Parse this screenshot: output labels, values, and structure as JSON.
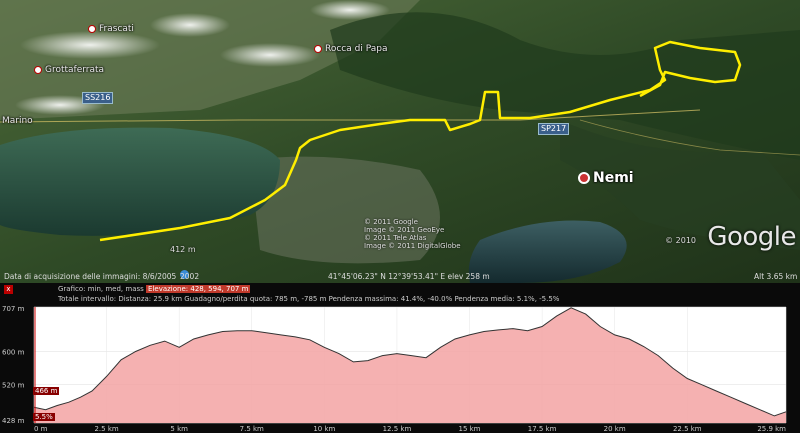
{
  "map": {
    "places": [
      {
        "name": "Frascati",
        "label": "Frascati"
      },
      {
        "name": "Grottaferrata",
        "label": "Grottaferrata"
      },
      {
        "name": "Rocca di Papa",
        "label": "Rocca di Papa"
      },
      {
        "name": "Marino",
        "label": "Marino"
      },
      {
        "name": "Nemi",
        "label": "Nemi"
      }
    ],
    "roads": {
      "r1": "SS216",
      "r2": "SP217"
    },
    "elevation_marker": "412 m",
    "copyright": "© 2011 Google\nImage © 2011 GeoEye\n© 2011 Tele Atlas\nImage © 2011 DigitalGlobe",
    "image_year": "© 2010",
    "logo": "Google",
    "route_color": "#ffee00"
  },
  "status": {
    "acquisition": "Data di acquisizione delle immagini: 8/6/2005",
    "tour_year": "2002",
    "coords": "41°45'06.23\" N  12°39'53.41\" E  elev  258 m",
    "alt": "Alt  3.65 km"
  },
  "profile": {
    "header_line1_prefix": "Grafico: min, med, mass",
    "elevation_label": "Elevazione: 428, 594, 707 m",
    "header_line2": "Totale intervallo: Distanza: 25.9 km   Guadagno/perdita quota: 785 m, -785 m   Pendenza massima: 41.4%, -40.0%   Pendenza media: 5.1%, -5.5%",
    "current_readout": "466 m",
    "current_slope": "5.5%",
    "close_label": "x"
  },
  "chart_data": {
    "type": "area",
    "title": "",
    "xlabel": "",
    "ylabel": "",
    "xlim": [
      0,
      25.9
    ],
    "ylim": [
      428,
      707
    ],
    "y_ticks": [
      {
        "v": 707,
        "label": "707 m"
      },
      {
        "v": 600,
        "label": "600 m"
      },
      {
        "v": 520,
        "label": "520 m"
      },
      {
        "v": 428,
        "label": "428 m"
      }
    ],
    "x_ticks": [
      {
        "v": 0,
        "label": "0 m"
      },
      {
        "v": 2.5,
        "label": "2.5 km"
      },
      {
        "v": 5,
        "label": "5 km"
      },
      {
        "v": 7.5,
        "label": "7.5 km"
      },
      {
        "v": 10,
        "label": "10 km"
      },
      {
        "v": 12.5,
        "label": "12.5 km"
      },
      {
        "v": 15,
        "label": "15 km"
      },
      {
        "v": 17.5,
        "label": "17.5 km"
      },
      {
        "v": 20,
        "label": "20 km"
      },
      {
        "v": 22.5,
        "label": "22.5 km"
      },
      {
        "v": 25.9,
        "label": "25.9 km"
      }
    ],
    "series": [
      {
        "x": [
          0,
          0.4,
          0.8,
          1.2,
          1.6,
          2.0,
          2.5,
          3.0,
          3.5,
          4.0,
          4.5,
          5.0,
          5.5,
          6.0,
          6.5,
          7.0,
          7.5,
          8.0,
          8.5,
          9.0,
          9.5,
          10.0,
          10.5,
          11.0,
          11.5,
          12.0,
          12.5,
          13.0,
          13.5,
          14.0,
          14.5,
          15.0,
          15.5,
          16.0,
          16.5,
          17.0,
          17.5,
          18.0,
          18.5,
          19.0,
          19.5,
          20.0,
          20.5,
          21.0,
          21.5,
          22.0,
          22.5,
          23.0,
          23.5,
          24.0,
          24.5,
          25.0,
          25.5,
          25.9
        ],
        "y": [
          466,
          460,
          470,
          478,
          490,
          505,
          540,
          580,
          600,
          615,
          625,
          610,
          630,
          640,
          648,
          650,
          650,
          645,
          640,
          635,
          628,
          610,
          595,
          575,
          578,
          590,
          595,
          590,
          585,
          610,
          630,
          640,
          648,
          652,
          655,
          650,
          660,
          685,
          705,
          690,
          660,
          640,
          630,
          612,
          590,
          560,
          535,
          520,
          505,
          490,
          475,
          460,
          445,
          455
        ]
      }
    ]
  }
}
